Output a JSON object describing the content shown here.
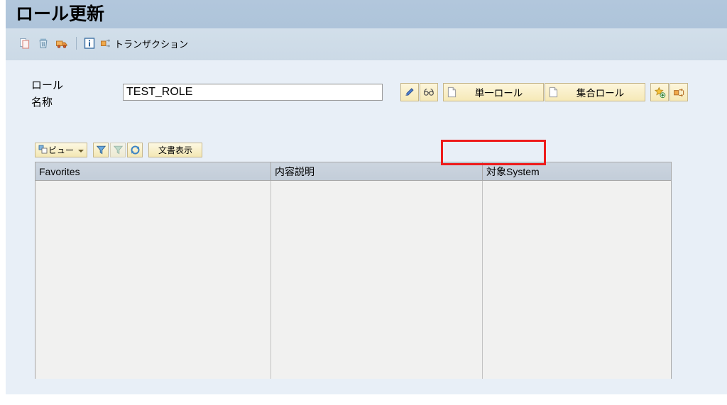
{
  "window": {
    "title": "ロール更新"
  },
  "toolbar": {
    "items": [
      {
        "name": "copy-icon",
        "label": ""
      },
      {
        "name": "delete-icon",
        "label": ""
      },
      {
        "name": "transport-icon",
        "label": ""
      },
      {
        "name": "info-icon",
        "label": ""
      }
    ],
    "transaction_label": "トランザクション"
  },
  "form": {
    "role_label": "ロール",
    "name_label": "名称",
    "role_value": "TEST_ROLE",
    "role_placeholder": ""
  },
  "role_actions": {
    "edit_label": "",
    "display_label": "",
    "single_role_label": "単一ロール",
    "composite_role_label": "集合ロール",
    "add_favorite_label": "",
    "transaction_label": ""
  },
  "table_toolbar": {
    "view_label": "ビュー",
    "filter_label": "",
    "filter_off_label": "",
    "refresh_label": "",
    "document_label": "文書表示"
  },
  "table": {
    "columns": [
      "Favorites",
      "内容説明",
      "対象System"
    ],
    "rows": []
  },
  "colors": {
    "title_bar": "#afc6dd",
    "toolbar": "#cfdce8",
    "content": "#e8eff7",
    "button": "#f6e9b7",
    "highlight": "#ee1c1c",
    "header": "#c8d1dc"
  }
}
